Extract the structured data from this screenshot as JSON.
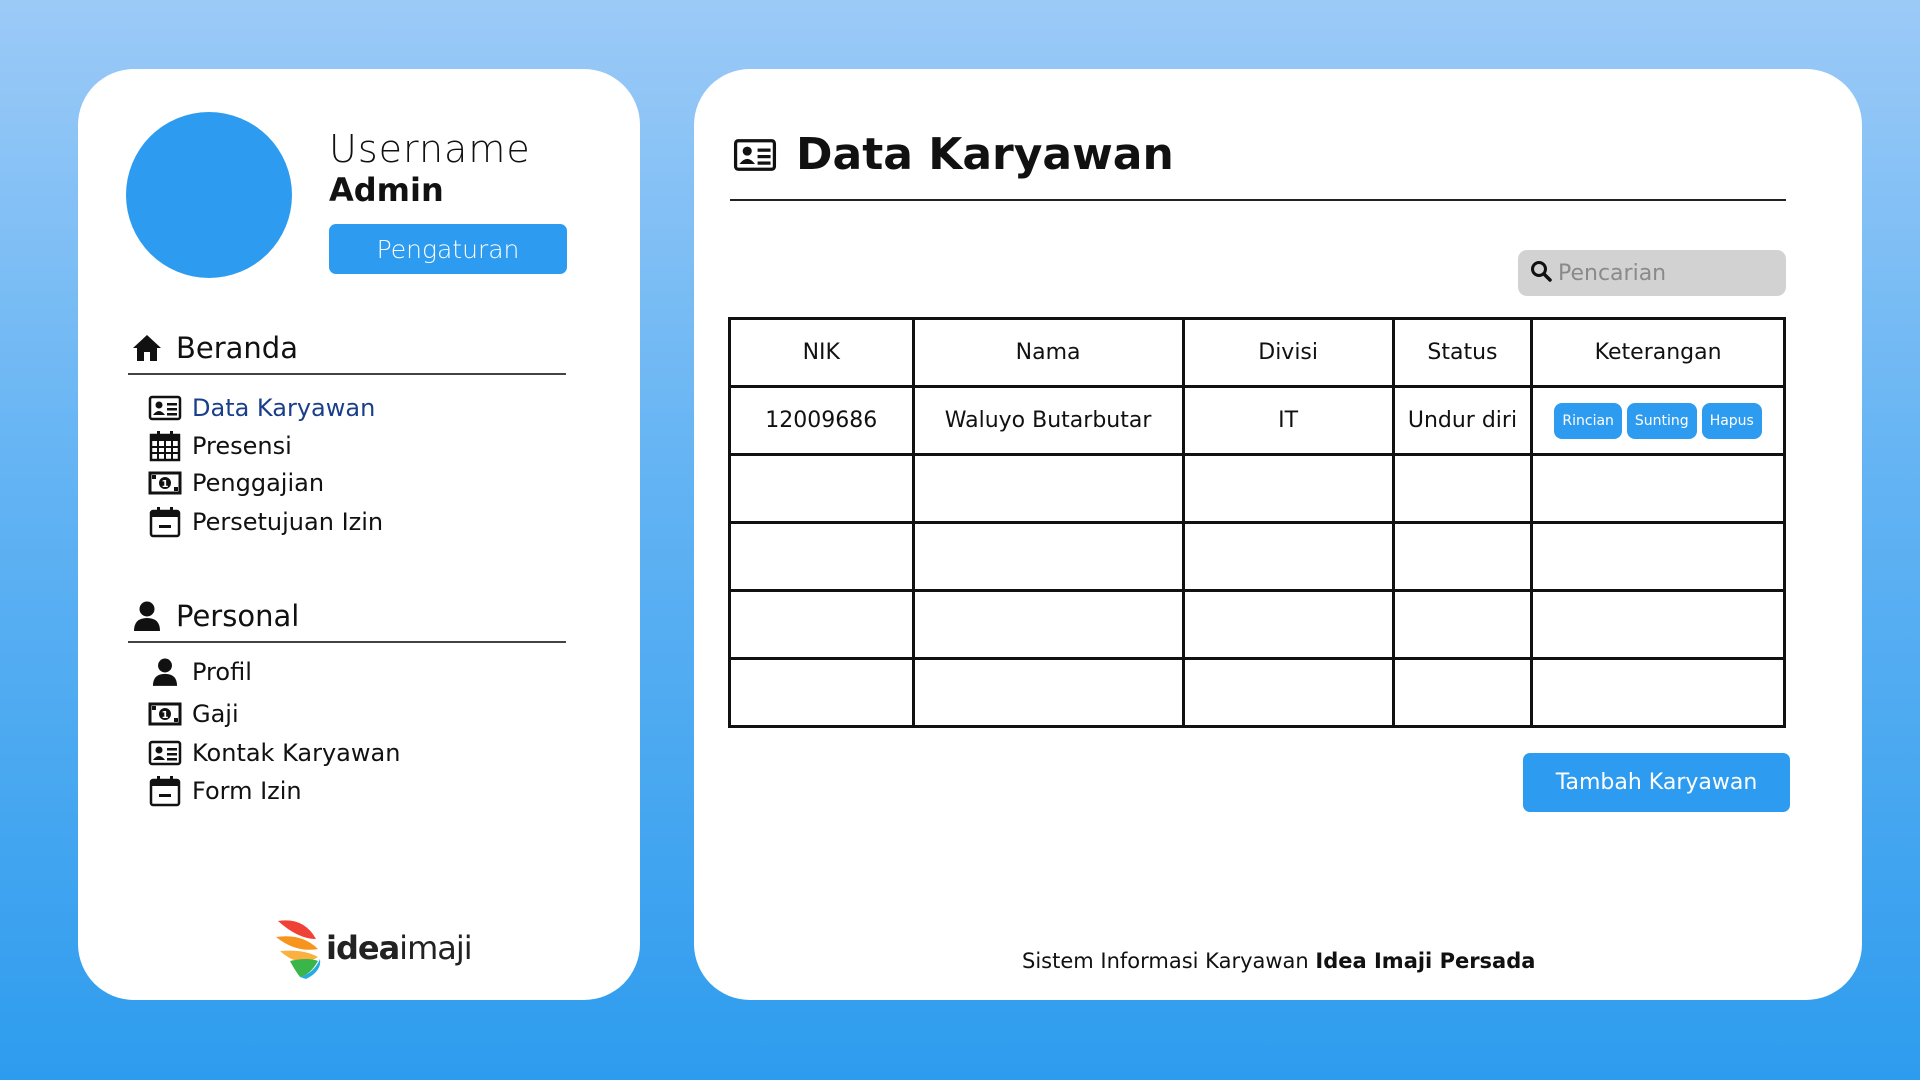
{
  "sidebar": {
    "user_label": "Username",
    "user_role": "Admin",
    "settings_label": "Pengaturan",
    "sections": [
      {
        "title": "Beranda",
        "icon": "home-icon",
        "items": [
          {
            "label": "Data Karyawan",
            "icon": "id-card-icon",
            "active": true
          },
          {
            "label": "Presensi",
            "icon": "calendar-grid-icon"
          },
          {
            "label": "Penggajian",
            "icon": "money-icon"
          },
          {
            "label": "Persetujuan Izin",
            "icon": "calendar-minus-icon"
          }
        ]
      },
      {
        "title": "Personal",
        "icon": "user-icon",
        "items": [
          {
            "label": "Profil",
            "icon": "user-icon"
          },
          {
            "label": "Gaji",
            "icon": "money-icon"
          },
          {
            "label": "Kontak Karyawan",
            "icon": "id-card-icon"
          },
          {
            "label": "Form Izin",
            "icon": "calendar-minus-icon"
          }
        ]
      }
    ],
    "logo": {
      "part1": "idea",
      "part2": "imaji"
    }
  },
  "main": {
    "title": "Data Karyawan",
    "search": {
      "placeholder": "Pencarian",
      "value": ""
    },
    "table": {
      "headers": [
        "NIK",
        "Nama",
        "Divisi",
        "Status",
        "Keterangan"
      ],
      "rows": [
        {
          "nik": "12009686",
          "nama": "Waluyo Butarbutar",
          "divisi": "IT",
          "status": "Undur diri",
          "actions": [
            "Rincian",
            "Sunting",
            "Hapus"
          ]
        },
        {
          "nik": "",
          "nama": "",
          "divisi": "",
          "status": "",
          "actions": []
        },
        {
          "nik": "",
          "nama": "",
          "divisi": "",
          "status": "",
          "actions": []
        },
        {
          "nik": "",
          "nama": "",
          "divisi": "",
          "status": "",
          "actions": []
        },
        {
          "nik": "",
          "nama": "",
          "divisi": "",
          "status": "",
          "actions": []
        }
      ]
    },
    "add_button": "Tambah Karyawan",
    "footer": {
      "text": "Sistem Informasi Karyawan",
      "company": "Idea Imaji Persada"
    }
  },
  "colors": {
    "accent": "#2d9cf0",
    "active_nav": "#1a3f8a",
    "search_bg": "#d2d2d2"
  }
}
